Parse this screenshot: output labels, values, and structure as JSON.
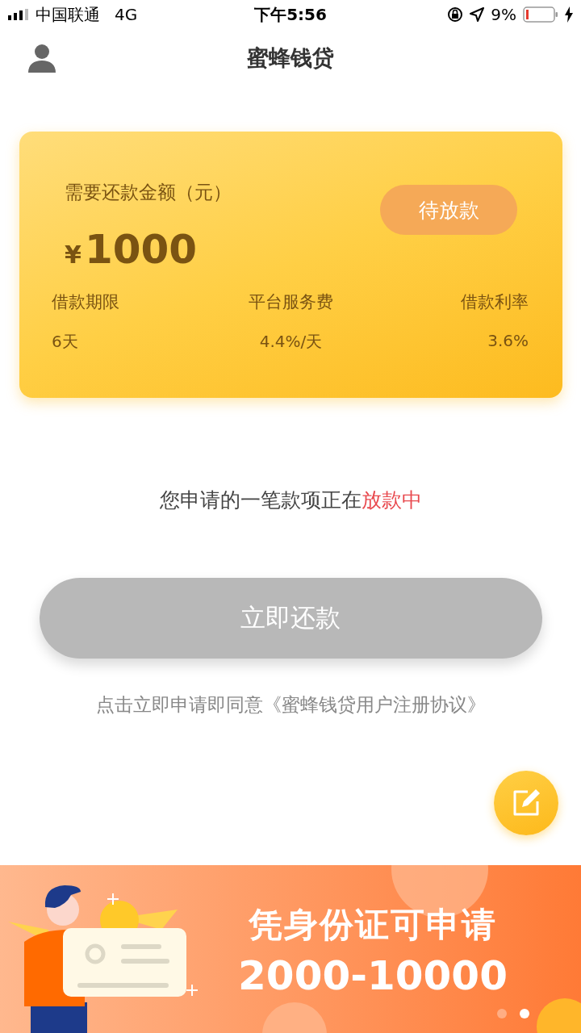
{
  "status_bar": {
    "carrier": "中国联通",
    "network": "4G",
    "time": "下午5:56",
    "battery": "9%"
  },
  "header": {
    "title": "蜜蜂钱贷"
  },
  "card": {
    "amount_label": "需要还款金额（元）",
    "currency": "¥",
    "amount": "1000",
    "status": "待放款",
    "stats": [
      {
        "label": "借款期限",
        "value": "6天"
      },
      {
        "label": "平台服务费",
        "value": "4.4%/天"
      },
      {
        "label": "借款利率",
        "value": "3.6%"
      }
    ]
  },
  "notice": {
    "text": "您申请的一笔款项正在",
    "highlight": "放款中"
  },
  "repay_button": {
    "label": "立即还款",
    "disabled": true
  },
  "agreement": "点击立即申请即同意《蜜蜂钱贷用户注册协议》",
  "banner": {
    "line1": "凭身份证可申请",
    "line2": "2000-10000",
    "dots": [
      {
        "selected": false
      },
      {
        "selected": true
      }
    ]
  }
}
